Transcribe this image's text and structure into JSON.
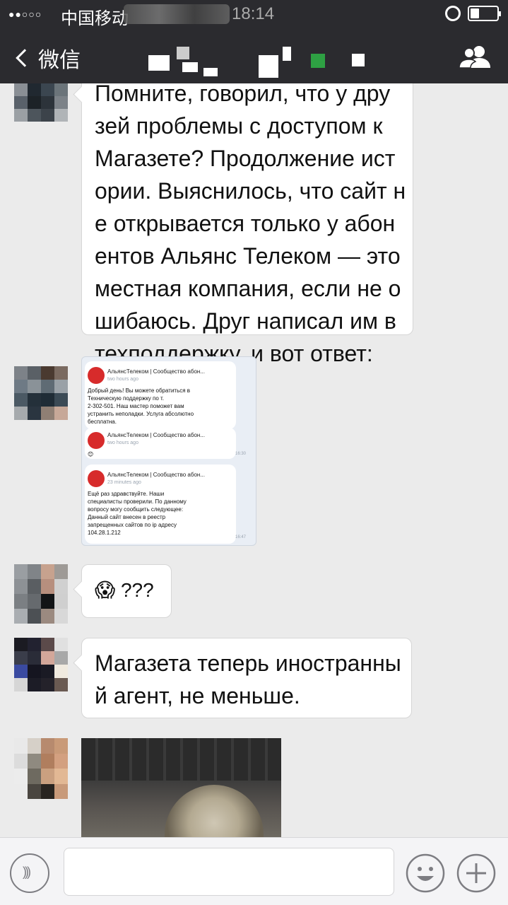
{
  "status_bar": {
    "carrier": "中国移动",
    "time": "18:14"
  },
  "nav": {
    "back_label": "微信"
  },
  "messages": [
    {
      "type": "text",
      "text": "Помните, говорил, что у дру\nзей проблемы с доступом к\nМагазете? Продолжение ист\nории. Выяснилось, что сайт н\nе открывается только у абон\nентов Альянс Телеком — это\nместная компания, если не о\nшибаюсь. Друг написал им в\nтехподдержку, и вот ответ:"
    },
    {
      "type": "image",
      "cards": [
        {
          "name": "АльянсТелеком | Сообщество абон...",
          "ago": "two hours ago",
          "text": "Добрый день! Вы можете обратиться в\nТехническую поддержку по т.\n2-302-501. Наш мастер поможет вам\nустранить неполадки. Услуга абсолютно\nбесплатна."
        },
        {
          "name": "АльянсТелеком | Сообщество абон...",
          "ago": "two hours ago",
          "text": "😊",
          "time": "16:30"
        },
        {
          "name": "АльянсТелеком | Сообщество абон...",
          "ago": "23 minutes ago",
          "text": "Ещё раз здравствуйте. Наши\nспециалисты проверили. По данному\nвопросу могу сообщить следующее:\nДанный сайт внесен в реестр\nзапрещенных сайтов по ip адресу\n104.28.1.212",
          "time": "16:47"
        }
      ]
    },
    {
      "type": "text",
      "text": "😱 ???"
    },
    {
      "type": "text",
      "text": "Магазета теперь иностранны\nй агент, не меньше."
    },
    {
      "type": "video"
    }
  ],
  "input_bar": {
    "placeholder": ""
  },
  "colors": {
    "nav_bg": "#2b2b2f",
    "chat_bg": "#ebebeb",
    "bubble_bg": "#ffffff"
  }
}
